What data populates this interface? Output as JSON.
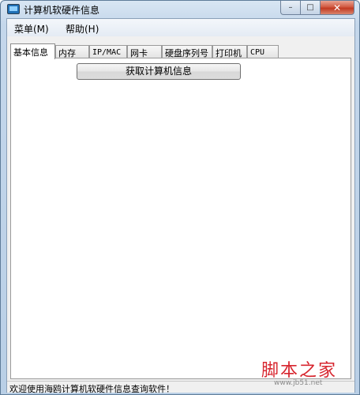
{
  "window": {
    "title": "计算机软硬件信息"
  },
  "caption": {
    "minimize": "–",
    "maximize": "□",
    "close": "✕"
  },
  "menu": [
    {
      "label": "菜单(M)"
    },
    {
      "label": "帮助(H)"
    }
  ],
  "tabs": [
    {
      "label": "基本信息",
      "active": true
    },
    {
      "label": "内存"
    },
    {
      "label": "IP/MAC"
    },
    {
      "label": "网卡"
    },
    {
      "label": "硬盘序列号"
    },
    {
      "label": "打印机"
    },
    {
      "label": "CPU"
    }
  ],
  "panel": {
    "fetch_button": "获取计算机信息"
  },
  "status": {
    "text": "欢迎使用海鸥计算机软硬件信息查询软件！"
  },
  "watermark": {
    "brand": "脚本之家",
    "url": "www.jb51.net"
  },
  "colors": {
    "watermark_red": "#d7262f",
    "app_icon": "#1f6fb5"
  }
}
